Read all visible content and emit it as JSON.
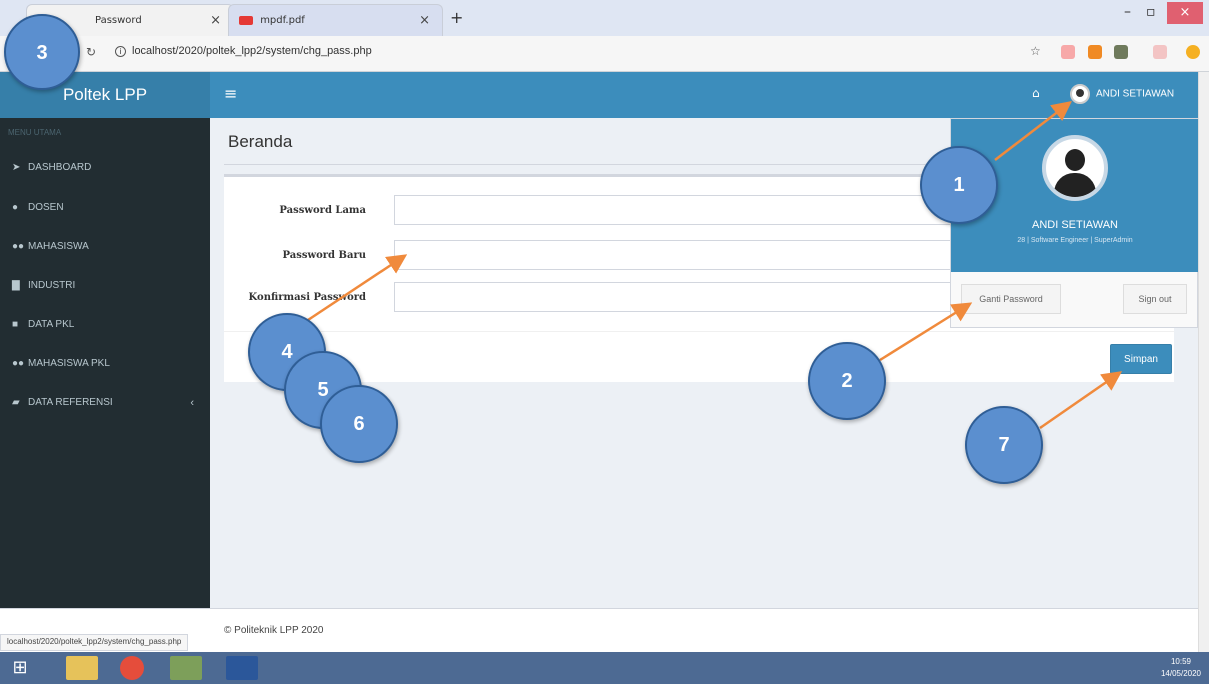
{
  "browser": {
    "tabs": [
      {
        "title": "Password"
      },
      {
        "title": "mpdf.pdf"
      }
    ],
    "url": "localhost/2020/poltek_lpp2/system/chg_pass.php",
    "status_url": "localhost/2020/poltek_lpp2/system/chg_pass.php"
  },
  "header": {
    "brand": "Poltek LPP",
    "user_name": "ANDI SETIAWAN"
  },
  "sidebar": {
    "section": "MENU UTAMA",
    "items": [
      {
        "label": "DASHBOARD",
        "icon": "paper-plane-icon"
      },
      {
        "label": "DOSEN",
        "icon": "user-icon"
      },
      {
        "label": "MAHASISWA",
        "icon": "users-icon"
      },
      {
        "label": "INDUSTRI",
        "icon": "industry-icon"
      },
      {
        "label": "DATA PKL",
        "icon": "list-icon"
      },
      {
        "label": "MAHASISWA PKL",
        "icon": "users-icon"
      },
      {
        "label": "DATA REFERENSI",
        "icon": "folder-icon"
      }
    ]
  },
  "main": {
    "title": "Beranda",
    "fields": [
      {
        "label": "Password Lama",
        "value": ""
      },
      {
        "label": "Password Baru",
        "value": ""
      },
      {
        "label": "Konfirmasi Password",
        "value": ""
      }
    ],
    "save_label": "Simpan"
  },
  "dropdown": {
    "name": "ANDI SETIAWAN",
    "subtitle": "28 | Software Engineer | SuperAdmin",
    "change_password": "Ganti Password",
    "sign_out": "Sign out"
  },
  "footer": {
    "text": "© Politeknik LPP 2020"
  },
  "taskbar": {
    "time": "10:59",
    "date": "14/05/2020"
  },
  "annotations": [
    "1",
    "2",
    "3",
    "4",
    "5",
    "6",
    "7"
  ],
  "colors": {
    "header": "#3c8dbc",
    "sidebar": "#222d32",
    "callout": "#5b8fcf",
    "arrow": "#f08a3c"
  }
}
